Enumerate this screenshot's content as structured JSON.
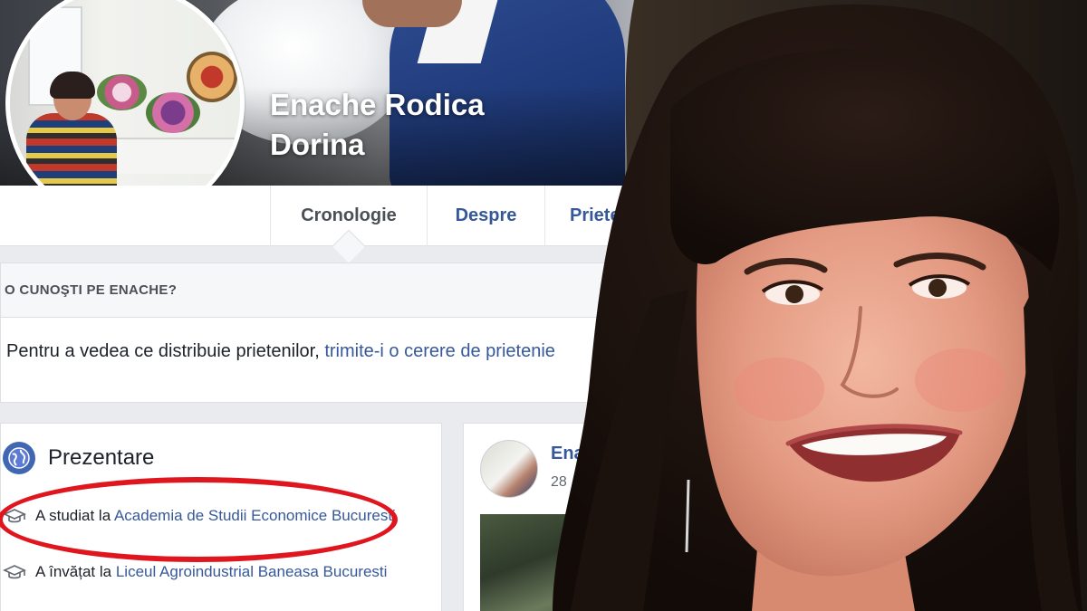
{
  "profile": {
    "name_line1": "Enache Rodica",
    "name_line2": "Dorina"
  },
  "tabs": [
    {
      "label": "Cronologie",
      "active": true
    },
    {
      "label": "Despre",
      "active": false
    },
    {
      "label": "Prieten",
      "active": false
    }
  ],
  "know_card": {
    "heading": "O CUNOŞTI PE ENACHE?",
    "body_text": "Pentru a vedea ce distribuie prietenilor, ",
    "link_text": "trimite-i o cerere de prietenie"
  },
  "intro": {
    "title": "Prezentare",
    "education": [
      {
        "prefix": "A studiat la ",
        "school": "Academia de Studii Economice Bucuresti",
        "highlighted": true
      },
      {
        "prefix": "A învățat la ",
        "school": "Liceul Agroindustrial Baneasa Bucuresti",
        "highlighted": false
      }
    ]
  },
  "post": {
    "author": "Ena",
    "date": "28"
  },
  "colors": {
    "link_blue": "#365899",
    "fb_blue": "#4267b2",
    "highlight_red": "#e0161e",
    "page_bg": "#e9ebee"
  },
  "icons": {
    "intro": "globe-icon",
    "education": "graduation-cap-icon"
  }
}
